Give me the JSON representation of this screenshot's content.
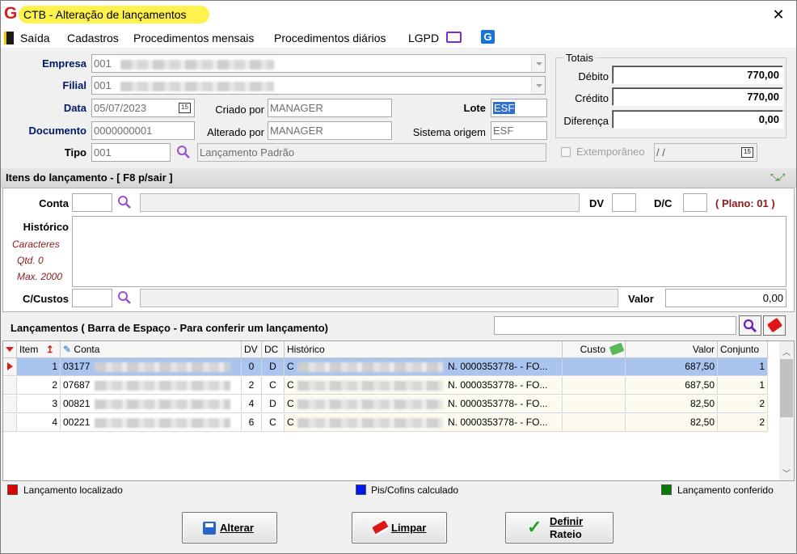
{
  "window": {
    "title": "CTB - Alteração de lançamentos"
  },
  "menu": [
    "Saída",
    "Cadastros",
    "Procedimentos mensais",
    "Procedimentos diários",
    "LGPD"
  ],
  "header": {
    "empresa_label": "Empresa",
    "empresa_value": "001",
    "filial_label": "Filial",
    "filial_value": "001",
    "data_label": "Data",
    "data_value": "05/07/2023",
    "documento_label": "Documento",
    "documento_value": "0000000001",
    "tipo_label": "Tipo",
    "tipo_value": "001",
    "tipo_desc": "Lançamento Padrão",
    "criado_label": "Criado por",
    "criado_value": "MANAGER",
    "alterado_label": "Alterado por",
    "alterado_value": "MANAGER",
    "lote_label": "Lote",
    "lote_value": "ESF",
    "sistema_label": "Sistema origem",
    "sistema_value": "ESF",
    "extemp_label": "Extemporâneo",
    "extemp_value": " / /"
  },
  "totais": {
    "title": "Totais",
    "debito_label": "Débito",
    "debito_value": "770,00",
    "credito_label": "Crédito",
    "credito_value": "770,00",
    "diferenca_label": "Diferença",
    "diferenca_value": "0,00"
  },
  "itens": {
    "section_title": "Itens do lançamento - [ F8 p/sair ]",
    "conta_label": "Conta",
    "dv_label": "DV",
    "dc_label": "D/C",
    "plano_label": "( Plano: 01 )",
    "historico_label": "Histórico",
    "caracteres_label": "Caracteres",
    "qtd_label": "Qtd. 0",
    "max_label": "Max. 2000",
    "ccustos_label": "C/Custos",
    "valor_label": "Valor",
    "valor_value": "0,00"
  },
  "lancamentos": {
    "title": "Lançamentos ( Barra de Espaço - Para conferir um lançamento)",
    "columns": [
      "Item",
      "Conta",
      "DV",
      "DC",
      "Histórico",
      "Custo",
      "Valor",
      "Conjunto"
    ],
    "rows": [
      {
        "item": "1",
        "conta": "03177",
        "dv": "0",
        "dc": "D",
        "hist_start": "C",
        "hist_end": "N. 0000353778- - FO...",
        "valor": "687,50",
        "conjunto": "1"
      },
      {
        "item": "2",
        "conta": "07687",
        "dv": "2",
        "dc": "C",
        "hist_start": "C",
        "hist_end": "N. 0000353778- - FO...",
        "valor": "687,50",
        "conjunto": "1"
      },
      {
        "item": "3",
        "conta": "00821",
        "dv": "4",
        "dc": "D",
        "hist_start": "C",
        "hist_end": "N. 0000353778- - FO...",
        "valor": "82,50",
        "conjunto": "2"
      },
      {
        "item": "4",
        "conta": "00221",
        "dv": "6",
        "dc": "C",
        "hist_start": "C",
        "hist_end": "N. 0000353778- - FO...",
        "valor": "82,50",
        "conjunto": "2"
      }
    ]
  },
  "legend": {
    "localizado": "Lançamento localizado",
    "localizado_color": "#e00000",
    "pis": "Pis/Cofins calculado",
    "pis_color": "#0018f0",
    "conferido": "Lançamento conferido",
    "conferido_color": "#087a08"
  },
  "buttons": {
    "alterar": "Alterar",
    "limpar": "Limpar",
    "definir": "Definir",
    "rateio": "Rateio"
  },
  "colors": {
    "selected_row": "#a9c4ee",
    "title_highlight": "#fff24d",
    "accent_blue": "#0a3a9e"
  }
}
